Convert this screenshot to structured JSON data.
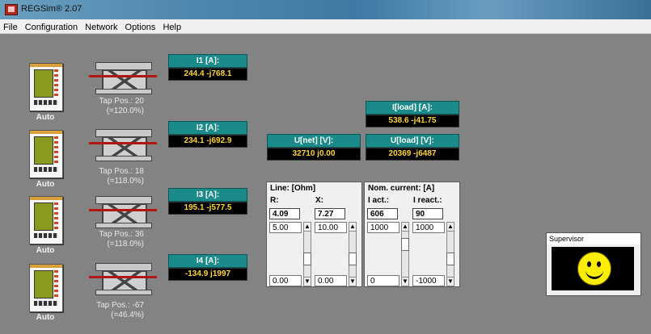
{
  "window": {
    "title": "REGSim® 2.07"
  },
  "menu": [
    "File",
    "Configuration",
    "Network",
    "Options",
    "Help"
  ],
  "units": [
    {
      "mode": "Auto",
      "tap": "Tap Pos.: 20",
      "tap_pct": "(=120.0%)",
      "current_label": "I1 [A]:",
      "current_value": "244.4 -j768.1"
    },
    {
      "mode": "Auto",
      "tap": "Tap Pos.: 18",
      "tap_pct": "(=118.0%)",
      "current_label": "I2 [A]:",
      "current_value": "234.1 -j692.9"
    },
    {
      "mode": "Auto",
      "tap": "Tap Pos.: 36",
      "tap_pct": "(=118.0%)",
      "current_label": "I3 [A]:",
      "current_value": "195.1 -j577.5"
    },
    {
      "mode": "Auto",
      "tap": "Tap Pos.: -67",
      "tap_pct": "(=46.4%)",
      "current_label": "I4 [A]:",
      "current_value": "-134.9 j1997"
    }
  ],
  "net": {
    "label": "U[net] [V]:",
    "value": "32710 j0.00"
  },
  "load_current": {
    "label": "I[load] [A]:",
    "value": "538.6 -j41.75"
  },
  "load_voltage": {
    "label": "U[load] [V]:",
    "value": "20369 -j6487"
  },
  "line_panel": {
    "title": "Line: [Ohm]",
    "r_label": "R:",
    "x_label": "X:",
    "r_value": "4.09",
    "x_value": "7.27",
    "r_max": "5.00",
    "r_min": "0.00",
    "x_max": "10.00",
    "x_min": "0.00"
  },
  "current_panel": {
    "title": "Nom. current: [A]",
    "act_label": "I act.:",
    "react_label": "I react.:",
    "act_value": "606",
    "react_value": "90",
    "act_max": "1000",
    "act_min": "0",
    "react_max": "1000",
    "react_min": "-1000"
  },
  "supervisor": {
    "title": "Supervisor"
  }
}
